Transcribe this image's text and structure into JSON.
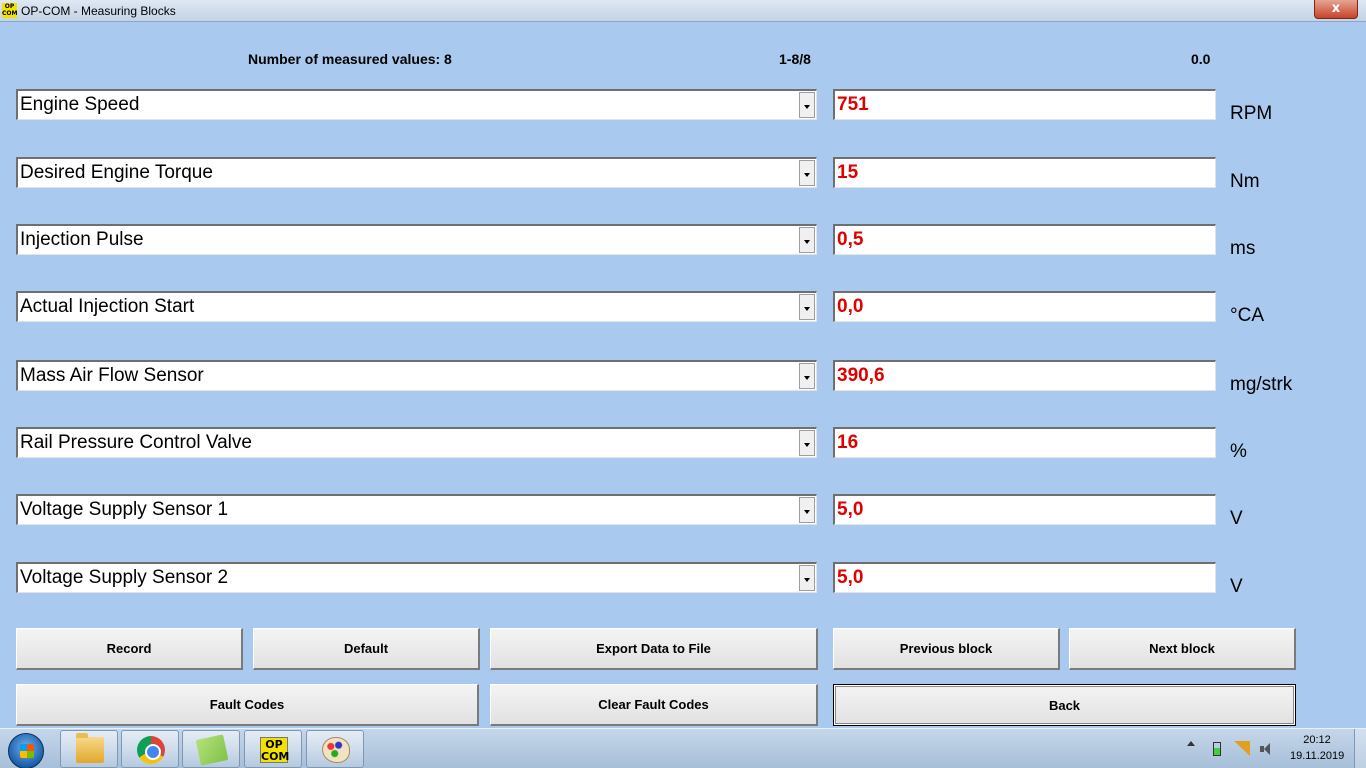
{
  "window": {
    "title": "OP-COM - Measuring Blocks",
    "app_icon_text": "OP COM",
    "close_label": "x"
  },
  "header": {
    "count_label": "Number of measured values: 8",
    "range_label": "1-8/8",
    "time_value": "0.0"
  },
  "rows": [
    {
      "label": "Engine Speed",
      "value": "751",
      "unit": "RPM"
    },
    {
      "label": "Desired Engine Torque",
      "value": "15",
      "unit": "Nm"
    },
    {
      "label": "Injection Pulse",
      "value": "0,5",
      "unit": "ms"
    },
    {
      "label": "Actual Injection Start",
      "value": "0,0",
      "unit": "°CA"
    },
    {
      "label": "Mass Air Flow Sensor",
      "value": "390,6",
      "unit": "mg/strk"
    },
    {
      "label": "Rail Pressure Control Valve",
      "value": "16",
      "unit": "%"
    },
    {
      "label": "Voltage Supply Sensor 1",
      "value": "5,0",
      "unit": "V"
    },
    {
      "label": "Voltage Supply Sensor 2",
      "value": "5,0",
      "unit": "V"
    }
  ],
  "buttons": {
    "record": "Record",
    "default": "Default",
    "export": "Export Data to File",
    "previous": "Previous block",
    "next": "Next block",
    "fault_codes": "Fault Codes",
    "clear_fault_codes": "Clear Fault Codes",
    "back": "Back"
  },
  "taskbar": {
    "icons": [
      "start-orb-icon",
      "file-explorer-icon",
      "chrome-icon",
      "sticky-notes-icon",
      "opcom-icon",
      "paint-icon"
    ],
    "opcom_icon_text": "OP COM",
    "clock_time": "20:12",
    "clock_date": "19.11.2019"
  },
  "colors": {
    "background": "#a9c9ee",
    "value_text": "#e00000"
  }
}
